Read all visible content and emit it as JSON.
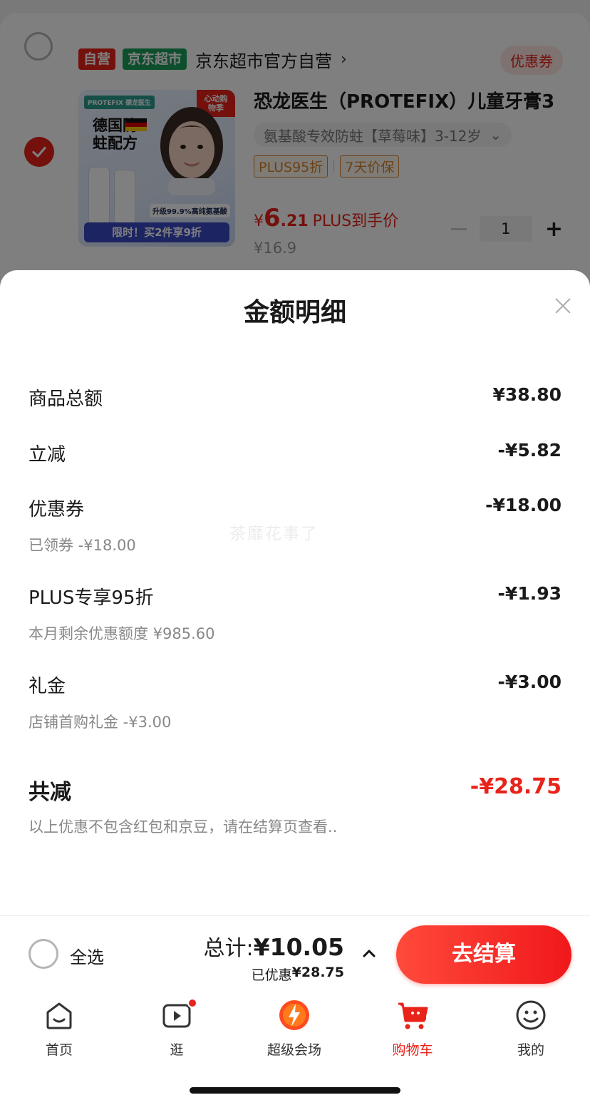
{
  "shop": {
    "tag_self": "自营",
    "tag_market": "京东超市",
    "name": "京东超市官方自营",
    "chevron": "›",
    "coupon_label": "优惠券"
  },
  "product": {
    "title": "恐龙医生（PROTEFIX）儿童牙膏3",
    "variant": "氨基酸专效防蛀【草莓味】3-12岁",
    "variant_chevron": "⌄",
    "promo_tags": [
      "PLUS95折",
      "7天价保"
    ],
    "price_symbol": "¥",
    "price_int": "6",
    "price_dec": ".21",
    "price_label": "PLUS到手价",
    "original_price": "¥16.9",
    "quantity": "1",
    "image": {
      "brand": "PROTEFIX 德龙医生",
      "badge": "心动购物季",
      "slogan": "德国防蛀配方",
      "tagline": "升级99.9%高纯氨基酸",
      "banner": "限时！买2件享9折"
    }
  },
  "sheet": {
    "title": "金额明细",
    "watermark": "茶靡花事了",
    "rows": [
      {
        "label": "商品总额",
        "value": "¥38.80",
        "sub": ""
      },
      {
        "label": "立减",
        "value": "-¥5.82",
        "sub": ""
      },
      {
        "label": "优惠券",
        "value": "-¥18.00",
        "sub": "已领券 -¥18.00"
      },
      {
        "label": "PLUS专享95折",
        "value": "-¥1.93",
        "sub": "本月剩余优惠额度 ¥985.60"
      },
      {
        "label": "礼金",
        "value": "-¥3.00",
        "sub": "店铺首购礼金 -¥3.00"
      }
    ],
    "total": {
      "label": "共减",
      "value": "-¥28.75",
      "sub": "以上优惠不包含红包和京豆，请在结算页查看.."
    }
  },
  "checkout": {
    "select_all": "全选",
    "total_label": "总计:",
    "total_value": "¥10.05",
    "saved_label": "已优惠",
    "saved_value": "¥28.75",
    "button": "去结算"
  },
  "tabs": [
    {
      "label": "首页",
      "icon": "home-icon"
    },
    {
      "label": "逛",
      "icon": "video-icon"
    },
    {
      "label": "超级会场",
      "icon": "super-venue-icon"
    },
    {
      "label": "购物车",
      "icon": "cart-icon"
    },
    {
      "label": "我的",
      "icon": "profile-icon"
    }
  ],
  "colors": {
    "accent": "#e8231a",
    "market_green": "#1a9c5b",
    "promo_orange": "#d9822b"
  }
}
